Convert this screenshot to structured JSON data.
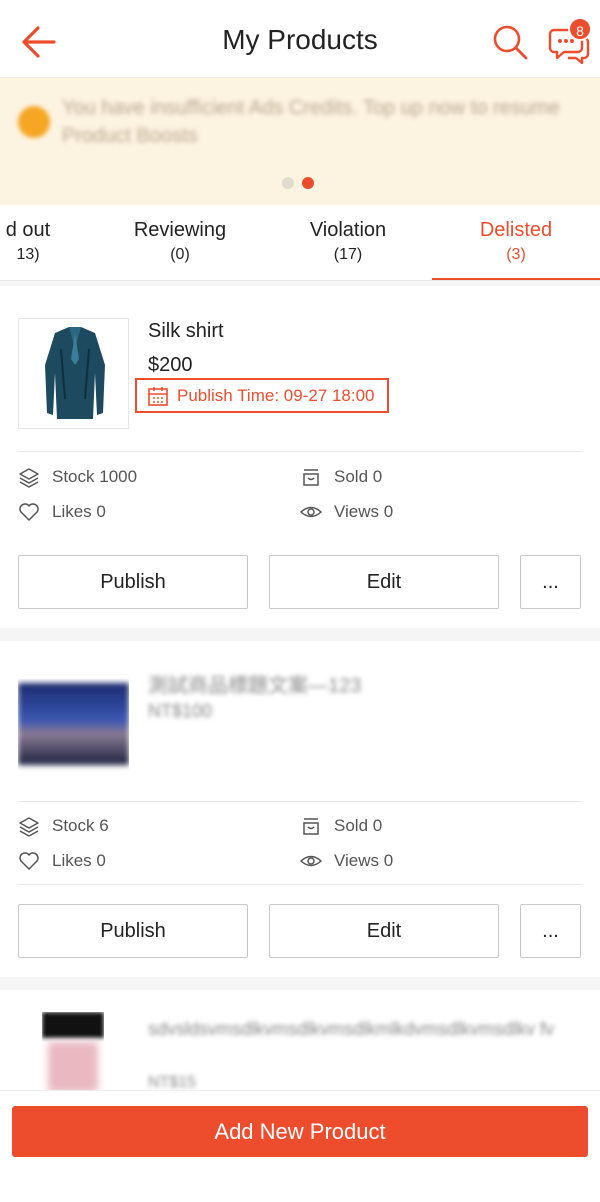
{
  "header": {
    "title": "My Products",
    "chat_badge": "8",
    "accent": "#ee4d2d"
  },
  "banner": {
    "message": "You have insufficient Ads Credits. Top up now to resume Product Boosts",
    "active_dot": 2
  },
  "tabs": [
    {
      "label": "d out",
      "count": "13)"
    },
    {
      "label": "Reviewing",
      "count": "(0)"
    },
    {
      "label": "Violation",
      "count": "(17)"
    },
    {
      "label": "Delisted",
      "count": "(3)"
    }
  ],
  "products": [
    {
      "name": "Silk shirt",
      "price": "$200",
      "publish_time": "Publish Time: 09-27 18:00",
      "stock": "Stock 1000",
      "sold": "Sold 0",
      "likes": "Likes 0",
      "views": "Views 0",
      "publish_label": "Publish",
      "edit_label": "Edit",
      "more_label": "..."
    },
    {
      "name": "測試商品標題文案—123",
      "price": "NT$100",
      "stock": "Stock 6",
      "sold": "Sold 0",
      "likes": "Likes 0",
      "views": "Views 0",
      "publish_label": "Publish",
      "edit_label": "Edit",
      "more_label": "..."
    },
    {
      "name": "sdvsldsvmsdlkvmsdlkvmsdlkmlkdvmsdlkvmsdlkv fv",
      "price": "NT$15"
    }
  ],
  "footer": {
    "add_label": "Add New Product"
  }
}
